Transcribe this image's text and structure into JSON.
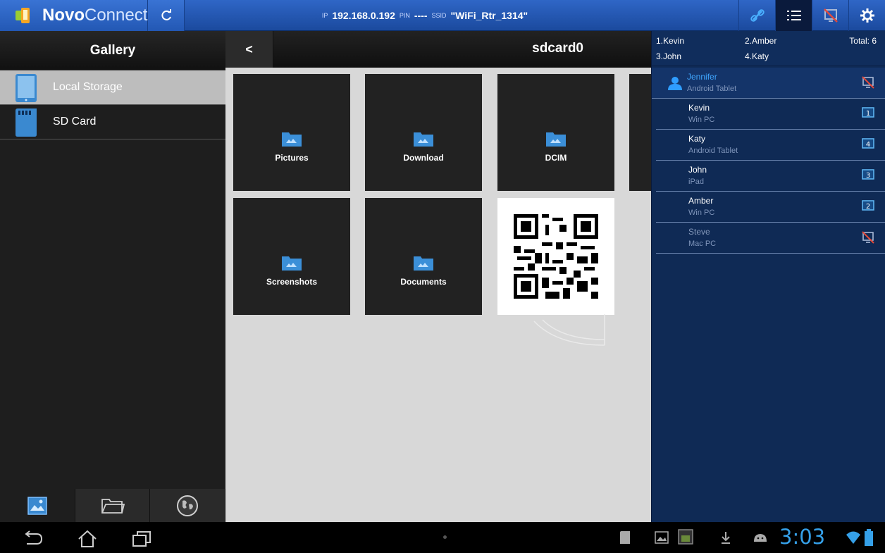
{
  "app": {
    "brand_bold": "Novo",
    "brand_light": "Connect"
  },
  "connection": {
    "ip_label": "IP",
    "ip_value": "192.168.0.192",
    "pin_label": "PIN",
    "pin_value": "----",
    "ssid_label": "SSID",
    "ssid_value": "\"WiFi_Rtr_1314\""
  },
  "toolbar": {
    "icons": [
      "link-icon",
      "list-icon",
      "projection-off-icon",
      "settings-icon"
    ]
  },
  "sidebar": {
    "title": "Gallery",
    "items": [
      {
        "label": "Local Storage",
        "icon": "tablet-icon",
        "selected": true
      },
      {
        "label": "SD Card",
        "icon": "sd-card-icon",
        "selected": false
      }
    ],
    "bottom_tabs": [
      "gallery-tab-icon",
      "folder-tab-icon",
      "web-tab-icon"
    ]
  },
  "main": {
    "back_label": "<",
    "path": "sdcard0",
    "folders": [
      {
        "label": "Pictures"
      },
      {
        "label": "Download"
      },
      {
        "label": "DCIM"
      },
      {
        "label": "Screenshots"
      },
      {
        "label": "Documents"
      }
    ]
  },
  "queue": {
    "entries": [
      "1.Kevin",
      "2.Amber",
      "3.John",
      "4.Katy"
    ],
    "total": "Total: 6"
  },
  "users": [
    {
      "name": "Jennifer",
      "device": "Android Tablet",
      "status": "not-presenting",
      "presenter": true
    },
    {
      "name": "Kevin",
      "device": "Win PC",
      "status": "1"
    },
    {
      "name": "Katy",
      "device": "Android Tablet",
      "status": "4"
    },
    {
      "name": "John",
      "device": "iPad",
      "status": "3"
    },
    {
      "name": "Amber",
      "device": "Win PC",
      "status": "2"
    },
    {
      "name": "Steve",
      "device": "Mac PC",
      "status": "not-presenting",
      "disabled": true
    }
  ],
  "system": {
    "clock": "3:03"
  }
}
